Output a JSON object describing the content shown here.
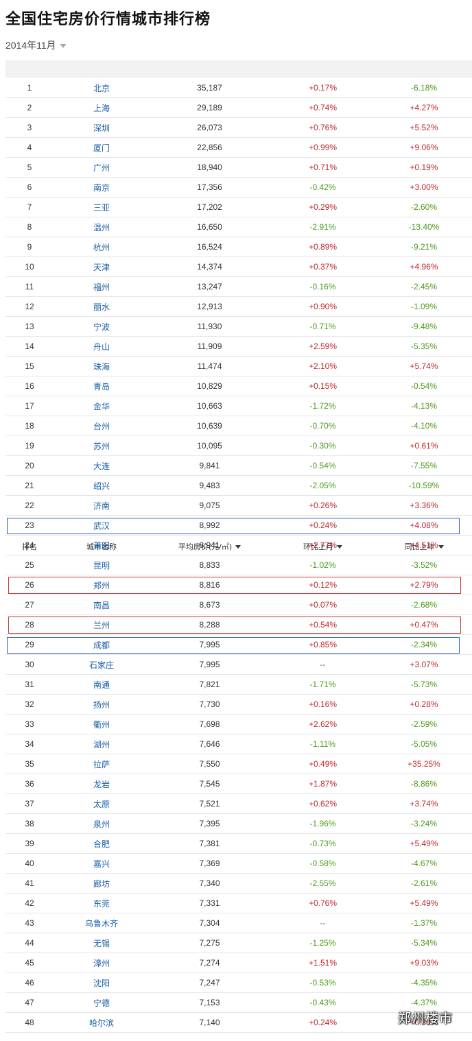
{
  "title": "全国住宅房价行情城市排行榜",
  "period": "2014年11月",
  "headers": {
    "rank": "排名",
    "city": "城市名称",
    "price": "平均房价(元/㎡)",
    "mom": "环比上月",
    "yoy": "同比上年"
  },
  "rows": [
    {
      "rank": "1",
      "city": "北京",
      "price": "35,187",
      "mom": "+0.17%",
      "yoy": "-6.18%"
    },
    {
      "rank": "2",
      "city": "上海",
      "price": "29,189",
      "mom": "+0.74%",
      "yoy": "+4.27%"
    },
    {
      "rank": "3",
      "city": "深圳",
      "price": "26,073",
      "mom": "+0.76%",
      "yoy": "+5.52%"
    },
    {
      "rank": "4",
      "city": "厦门",
      "price": "22,856",
      "mom": "+0.99%",
      "yoy": "+9.06%"
    },
    {
      "rank": "5",
      "city": "广州",
      "price": "18,940",
      "mom": "+0.71%",
      "yoy": "+0.19%"
    },
    {
      "rank": "6",
      "city": "南京",
      "price": "17,356",
      "mom": "-0.42%",
      "yoy": "+3.00%"
    },
    {
      "rank": "7",
      "city": "三亚",
      "price": "17,202",
      "mom": "+0.29%",
      "yoy": "-2.60%"
    },
    {
      "rank": "8",
      "city": "温州",
      "price": "16,650",
      "mom": "-2.91%",
      "yoy": "-13.40%"
    },
    {
      "rank": "9",
      "city": "杭州",
      "price": "16,524",
      "mom": "+0.89%",
      "yoy": "-9.21%"
    },
    {
      "rank": "10",
      "city": "天津",
      "price": "14,374",
      "mom": "+0.37%",
      "yoy": "+4.96%"
    },
    {
      "rank": "11",
      "city": "福州",
      "price": "13,247",
      "mom": "-0.16%",
      "yoy": "-2.45%"
    },
    {
      "rank": "12",
      "city": "丽水",
      "price": "12,913",
      "mom": "+0.90%",
      "yoy": "-1.09%"
    },
    {
      "rank": "13",
      "city": "宁波",
      "price": "11,930",
      "mom": "-0.71%",
      "yoy": "-9.48%"
    },
    {
      "rank": "14",
      "city": "舟山",
      "price": "11,909",
      "mom": "+2.59%",
      "yoy": "-5.35%"
    },
    {
      "rank": "15",
      "city": "珠海",
      "price": "11,474",
      "mom": "+2.10%",
      "yoy": "+5.74%"
    },
    {
      "rank": "16",
      "city": "青岛",
      "price": "10,829",
      "mom": "+0.15%",
      "yoy": "-0.54%"
    },
    {
      "rank": "17",
      "city": "金华",
      "price": "10,663",
      "mom": "-1.72%",
      "yoy": "-4.13%"
    },
    {
      "rank": "18",
      "city": "台州",
      "price": "10,639",
      "mom": "-0.70%",
      "yoy": "-4.10%"
    },
    {
      "rank": "19",
      "city": "苏州",
      "price": "10,095",
      "mom": "-0.30%",
      "yoy": "+0.61%"
    },
    {
      "rank": "20",
      "city": "大连",
      "price": "9,841",
      "mom": "-0.54%",
      "yoy": "-7.55%"
    },
    {
      "rank": "21",
      "city": "绍兴",
      "price": "9,483",
      "mom": "-2.05%",
      "yoy": "-10.59%"
    },
    {
      "rank": "22",
      "city": "济南",
      "price": "9,075",
      "mom": "+0.26%",
      "yoy": "+3.36%"
    },
    {
      "rank": "23",
      "city": "武汉",
      "price": "8,992",
      "mom": "+0.24%",
      "yoy": "+4.08%"
    },
    {
      "rank": "24",
      "city": "莆田",
      "price": "8,941",
      "mom": "+2.77%",
      "yoy": "+4.51%"
    },
    {
      "rank": "25",
      "city": "昆明",
      "price": "8,833",
      "mom": "-1.02%",
      "yoy": "-3.52%"
    },
    {
      "rank": "26",
      "city": "郑州",
      "price": "8,816",
      "mom": "+0.12%",
      "yoy": "+2.79%"
    },
    {
      "rank": "27",
      "city": "南昌",
      "price": "8,673",
      "mom": "+0.07%",
      "yoy": "-2.68%"
    },
    {
      "rank": "28",
      "city": "兰州",
      "price": "8,288",
      "mom": "+0.54%",
      "yoy": "+0.47%"
    },
    {
      "rank": "29",
      "city": "成都",
      "price": "7,995",
      "mom": "+0.85%",
      "yoy": "-2.34%"
    },
    {
      "rank": "30",
      "city": "石家庄",
      "price": "7,995",
      "mom": "--",
      "yoy": "+3.07%"
    },
    {
      "rank": "31",
      "city": "南通",
      "price": "7,821",
      "mom": "-1.71%",
      "yoy": "-5.73%"
    },
    {
      "rank": "32",
      "city": "扬州",
      "price": "7,730",
      "mom": "+0.16%",
      "yoy": "+0.28%"
    },
    {
      "rank": "33",
      "city": "衢州",
      "price": "7,698",
      "mom": "+2.62%",
      "yoy": "-2.59%"
    },
    {
      "rank": "34",
      "city": "湖州",
      "price": "7,646",
      "mom": "-1.11%",
      "yoy": "-5.05%"
    },
    {
      "rank": "35",
      "city": "拉萨",
      "price": "7,550",
      "mom": "+0.49%",
      "yoy": "+35.25%"
    },
    {
      "rank": "36",
      "city": "龙岩",
      "price": "7,545",
      "mom": "+1.87%",
      "yoy": "-8.86%"
    },
    {
      "rank": "37",
      "city": "太原",
      "price": "7,521",
      "mom": "+0.62%",
      "yoy": "+3.74%"
    },
    {
      "rank": "38",
      "city": "泉州",
      "price": "7,395",
      "mom": "-1.96%",
      "yoy": "-3.24%"
    },
    {
      "rank": "39",
      "city": "合肥",
      "price": "7,381",
      "mom": "-0.73%",
      "yoy": "+5.49%"
    },
    {
      "rank": "40",
      "city": "嘉兴",
      "price": "7,369",
      "mom": "-0.58%",
      "yoy": "-4.67%"
    },
    {
      "rank": "41",
      "city": "廊坊",
      "price": "7,340",
      "mom": "-2.55%",
      "yoy": "-2.61%"
    },
    {
      "rank": "42",
      "city": "东莞",
      "price": "7,331",
      "mom": "+0.76%",
      "yoy": "+5.49%"
    },
    {
      "rank": "43",
      "city": "乌鲁木齐",
      "price": "7,304",
      "mom": "--",
      "yoy": "-1.37%"
    },
    {
      "rank": "44",
      "city": "无锡",
      "price": "7,275",
      "mom": "-1.25%",
      "yoy": "-5.34%"
    },
    {
      "rank": "45",
      "city": "漳州",
      "price": "7,274",
      "mom": "+1.51%",
      "yoy": "+9.03%"
    },
    {
      "rank": "46",
      "city": "沈阳",
      "price": "7,247",
      "mom": "-0.53%",
      "yoy": "-4.35%"
    },
    {
      "rank": "47",
      "city": "宁德",
      "price": "7,153",
      "mom": "-0.43%",
      "yoy": "-4.37%"
    },
    {
      "rank": "48",
      "city": "哈尔滨",
      "price": "7,140",
      "mom": "+0.24%",
      "yoy": "+0.30%"
    }
  ],
  "highlights": [
    {
      "rank": "23",
      "color": "blue"
    },
    {
      "rank": "26",
      "color": "red"
    },
    {
      "rank": "28",
      "color": "red"
    },
    {
      "rank": "29",
      "color": "blue"
    }
  ],
  "colors": {
    "up": "#c0282e",
    "down": "#4d9a1c",
    "link": "#1a5fa8"
  },
  "watermark": "郑州楼市"
}
